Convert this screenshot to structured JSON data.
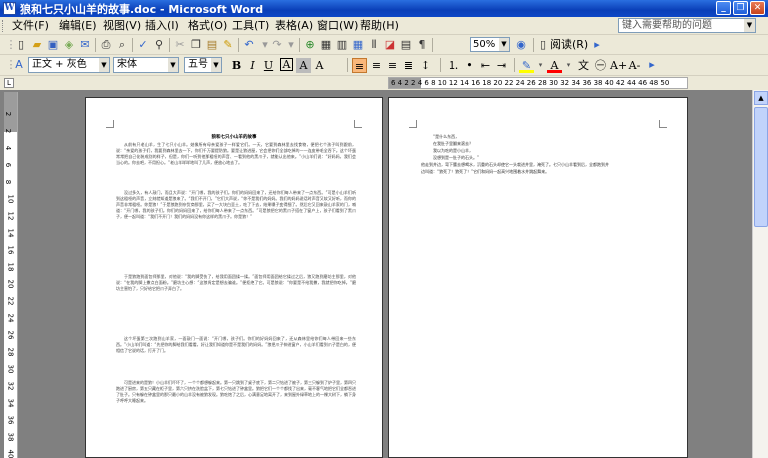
{
  "window": {
    "title": "狼和七只小山羊的故事.doc - Microsoft Word",
    "icon": "W",
    "min": "_",
    "restore": "❐",
    "close": "✕"
  },
  "menu": {
    "items": [
      "文件(F)",
      "编辑(E)",
      "视图(V)",
      "插入(I)",
      "格式(O)",
      "工具(T)",
      "表格(A)",
      "窗口(W)",
      "帮助(H)"
    ],
    "help_placeholder": "键入需要帮助的问题"
  },
  "toolbar": {
    "zoom": "50%",
    "read_label": "阅读(R)"
  },
  "format": {
    "style": "正文 + 灰色",
    "font": "宋体",
    "size": "五号",
    "bold": "B",
    "italic": "I",
    "underline": "U",
    "char_border": "A",
    "char_shade": "A",
    "scale": "A",
    "highlight_color": "#ffff00",
    "font_color": "#ff0000",
    "grow": "A+",
    "shrink": "A-"
  },
  "ruler": {
    "corner": "L",
    "h_ticks": "6 4 2 2 4 6 8 10 12 14 16 18 20 22 24 26 28 30 32 34 36 38 40 42 44 46 48 50",
    "v_ticks": [
      "2",
      "2",
      "4",
      "6",
      "8",
      "10",
      "12",
      "14",
      "16",
      "18",
      "20",
      "22",
      "24",
      "26",
      "28",
      "30",
      "32",
      "34",
      "36",
      "38",
      "40"
    ]
  },
  "page1": {
    "title": "狼和七只小山羊的故事",
    "paragraphs": [
      "从前有只老山羊，生了七只小山羊。她像所有母亲爱孩子一样爱它们。一天，它要到森林里去找食物，便把七个孩子叫到跟前，说：“亲爱的孩子们，我要到森林里去一下，你们千万要提防狼。要是让狼进屋，它会把你们全部吃掉的——连皮带毛全吞下。这个坏蛋常常把自己化装成别的样子，但是，你们一听到他那粗哑的声音、一看到他的黑爪子，就能认出他来。”小山羊们说：“好妈妈，我们会当心的。你去吧，不用担心。”老山羊咩咩地叫了几声，便放心地去了。",
      "没过多久，有人敲门，而且大声说：“开门哪，我的孩子们。你们的妈妈回来了，还给你们每人带来了一点东西。”可是小山羊们听到这粗哑的声音，立刻就知道是狼来了。“我们不开门，”它们大声说，“你不是我们的妈妈。我们的妈妈说话时声音又软又好听，而你的声音非常粗哑。你是狼！”于是狼跑到杂货商那里，买了一大块白垩土，吃了下去，结果嗓子变得细了。然后它又回来敲山羊家的门，喊道：“开门哪，我的孩子们。你们的妈妈回来了，给你们每人带来了一点东西。”可是狼把它的黑爪子搭在了窗户上，孩子们看到了黑爪子，便一起叫道：“我们不开门！我们的妈妈没有你这样的黑爪子。你是狼！”",
      "于是狼跑到面包师那里，对他说：“我的脚受伤了，给我用面团揉一揉。”面包师用面团给它揉过之后，狼又跑到磨坊主那里，对他说：“在我的脚上撒点白面粉。”磨坊主心想：“这狼肯定是想去骗谁。”便拒绝了它。可是狼说：“你要是不给我撒，我就把你吃掉。”磨坊主害怕了，只好给它把爪子弄白了。",
      "这个坏蛋第三次跑到山羊家，一面敲门一面说：“开门哪，孩子们。你们的好妈妈回来了，还从森林里给你们每人带回来一些东西。”小山羊们叫道：“先把你的脚给我们看看，好让我们知道你是不是我们的妈妈。”狼把爪子伸进窗户，小山羊们看到爪子是白的，便相信了它说的话，打开了门。",
      "可是进来的是狼！小山羊们吓坏了，一个个都想躲起来。第一只跳到了桌子底下，第二只钻进了被子，第三只躲到了炉子里，第四只跑进了厨房，第五只藏在柜子里，第六只挤在洗脸盆下，第七只钻进了钟盒里。狼把它们一个个都找了出来，毫不客气地把它们全都吞进了肚子。只有躲在钟盒里的那只最小的山羊没有被狼发现。狼吃饱了之后，心满意足地离开了，来到屋外绿草地上的一棵大树下，躺下身子呼呼大睡起来。"
    ]
  },
  "page2": {
    "lines": [
      "“是什么东西，",
      "在我肚子里翻来滚去？",
      "我以为吃的是小山羊，",
      "没想到是一肚子的石头。”",
      "他走到井边，弯下腰去想喝水，沉重的石头却使它一头栽进井里，淹死了。七只小山羊看到后，全都跑到井",
      "边叫道：“狼死了！狼死了！”它们和妈妈一起高兴地围着水井跳起舞来。"
    ]
  }
}
